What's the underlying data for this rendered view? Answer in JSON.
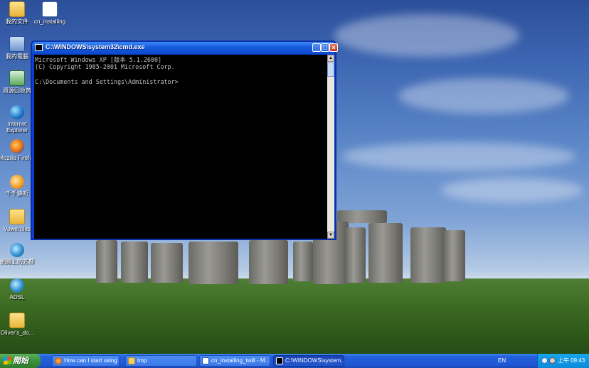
{
  "desktop": {
    "icons": [
      {
        "label": "我的文件",
        "icon": "folder-icon"
      },
      {
        "label": "cn_installing",
        "icon": "word-document-icon"
      },
      {
        "label": "我的電腦",
        "icon": "my-computer-icon"
      },
      {
        "label": "資源回收筒",
        "icon": "recycle-bin-icon"
      },
      {
        "label": "Internet Explorer",
        "icon": "internet-explorer-icon"
      },
      {
        "label": "Mozilla Firefox",
        "icon": "firefox-icon"
      },
      {
        "label": "千千静听",
        "icon": "music-player-icon"
      },
      {
        "label": "Vowel files",
        "icon": "folder-icon"
      },
      {
        "label": "網路上的芳鄰",
        "icon": "network-places-icon"
      },
      {
        "label": "ADSL",
        "icon": "network-connection-icon"
      },
      {
        "label": "Oliver's_do...",
        "icon": "folder-icon"
      }
    ]
  },
  "cmd_window": {
    "title": "C:\\WINDOWS\\system32\\cmd.exe",
    "buttons": {
      "minimize": "_",
      "maximize": "□",
      "close": "×"
    },
    "lines": [
      "Microsoft Windows XP [版本 5.1.2600]",
      "(C) Copyright 1985-2001 Microsoft Corp.",
      "",
      "C:\\Documents and Settings\\Administrator>"
    ]
  },
  "taskbar": {
    "start_label": "開始",
    "tasks": [
      {
        "label": "How can I start using t...",
        "icon": "firefox-icon",
        "active": false
      },
      {
        "label": "tmp",
        "icon": "folder-icon",
        "active": false
      },
      {
        "label": "cn_installing_twill - M...",
        "icon": "word-document-icon",
        "active": false
      },
      {
        "label": "C:\\WINDOWS\\system...",
        "icon": "cmd-icon",
        "active": true
      }
    ],
    "language": "EN",
    "clock": "上午 09:43"
  }
}
